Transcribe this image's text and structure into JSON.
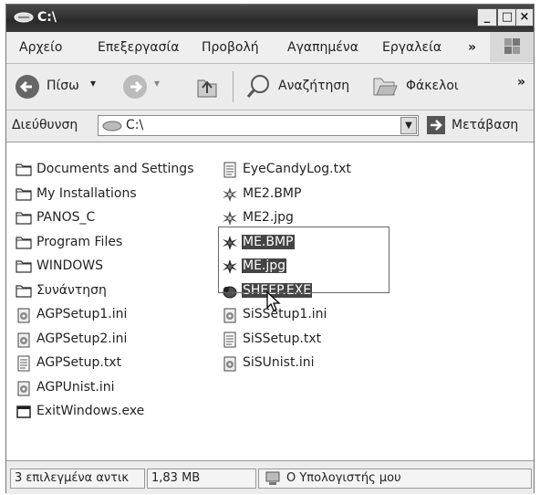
{
  "window": {
    "title": "C:\\"
  },
  "menu": [
    "Αρχείο",
    "Επεξεργασία",
    "Προβολή",
    "Αγαπημένα",
    "Εργαλεία"
  ],
  "toolbar": {
    "back_label": "Πίσω",
    "search_label": "Αναζήτηση",
    "folders_label": "Φάκελοι",
    "overflow": "»"
  },
  "address": {
    "label": "Διεύθυνση",
    "value": "C:\\",
    "go_label": "Μετάβαση"
  },
  "files_left": [
    {
      "name": "Documents and Settings",
      "icon": "folder-icon"
    },
    {
      "name": "My Installations",
      "icon": "folder-icon"
    },
    {
      "name": "PANOS_C",
      "icon": "folder-icon"
    },
    {
      "name": "Program Files",
      "icon": "folder-icon"
    },
    {
      "name": "WINDOWS",
      "icon": "folder-icon"
    },
    {
      "name": "Συνάντηση",
      "icon": "folder-icon"
    },
    {
      "name": "AGPSetup1.ini",
      "icon": "settings-file-icon"
    },
    {
      "name": "AGPSetup2.ini",
      "icon": "settings-file-icon"
    },
    {
      "name": "AGPSetup.txt",
      "icon": "text-file-icon"
    },
    {
      "name": "AGPUnist.ini",
      "icon": "settings-file-icon"
    },
    {
      "name": "ExitWindows.exe",
      "icon": "exe-icon"
    }
  ],
  "files_right": [
    {
      "name": "EyeCandyLog.txt",
      "icon": "text-file-icon",
      "selected": false
    },
    {
      "name": "ME2.BMP",
      "icon": "image-file-icon",
      "selected": false
    },
    {
      "name": "ME2.jpg",
      "icon": "image-file-icon",
      "selected": false
    },
    {
      "name": "ME.BMP",
      "icon": "image-file-icon",
      "selected": true
    },
    {
      "name": "ME.jpg",
      "icon": "image-file-icon",
      "selected": true
    },
    {
      "name": "SHEEP.EXE",
      "icon": "sheep-icon",
      "selected": true
    },
    {
      "name": "SiSSetup1.ini",
      "icon": "settings-file-icon",
      "selected": false
    },
    {
      "name": "SiSSetup.txt",
      "icon": "text-file-icon",
      "selected": false
    },
    {
      "name": "SiSUnist.ini",
      "icon": "settings-file-icon",
      "selected": false
    }
  ],
  "status": {
    "selection": "3 επιλεγμένα αντικ",
    "size": "1,83 MB",
    "location": "Ο Υπολογιστής μου"
  }
}
